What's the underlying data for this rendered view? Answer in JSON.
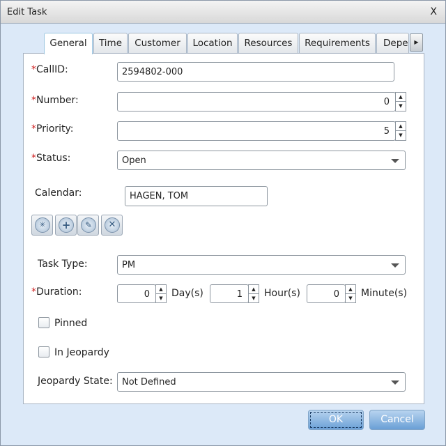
{
  "window": {
    "title": "Edit Task",
    "close": "X"
  },
  "tabs": [
    {
      "label": "General",
      "active": true
    },
    {
      "label": "Time"
    },
    {
      "label": "Customer"
    },
    {
      "label": "Location"
    },
    {
      "label": "Resources"
    },
    {
      "label": "Requirements"
    },
    {
      "label": "Depe"
    }
  ],
  "form": {
    "required_mark": "*",
    "callid": {
      "label": "CallID:",
      "value": "2594802-000"
    },
    "number": {
      "label": "Number:",
      "value": "0"
    },
    "priority": {
      "label": "Priority:",
      "value": "5"
    },
    "status": {
      "label": "Status:",
      "value": "Open"
    },
    "calendar": {
      "label": "Calendar:",
      "value": "HAGEN, TOM"
    },
    "calendar_buttons": [
      "browse-icon",
      "add-icon",
      "edit-icon",
      "remove-icon"
    ],
    "task_type": {
      "label": "Task Type:",
      "value": "PM"
    },
    "duration": {
      "label": "Duration:",
      "days": "0",
      "days_unit": "Day(s)",
      "hours": "1",
      "hours_unit": "Hour(s)",
      "minutes": "0",
      "minutes_unit": "Minute(s)"
    },
    "pinned": {
      "label": "Pinned",
      "checked": false
    },
    "in_jeopardy": {
      "label": "In Jeopardy",
      "checked": false
    },
    "jeopardy_state": {
      "label": "Jeopardy State:",
      "value": "Not Defined"
    }
  },
  "buttons": {
    "ok": "OK",
    "cancel": "Cancel"
  }
}
